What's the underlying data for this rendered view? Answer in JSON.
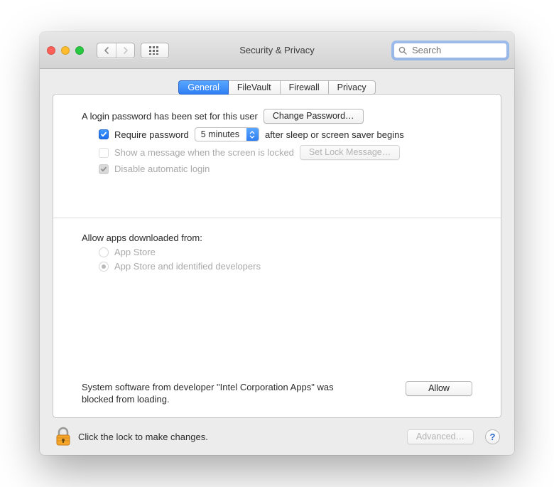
{
  "window": {
    "title": "Security & Privacy"
  },
  "toolbar": {
    "search_placeholder": "Search"
  },
  "tabs": [
    "General",
    "FileVault",
    "Firewall",
    "Privacy"
  ],
  "active_tab": 0,
  "general": {
    "password_set_text": "A login password has been set for this user",
    "change_password_btn": "Change Password…",
    "require_password_label": "Require password",
    "delay_value": "5 minutes",
    "after_sleep_text": "after sleep or screen saver begins",
    "show_message_label": "Show a message when the screen is locked",
    "set_lock_message_btn": "Set Lock Message…",
    "disable_auto_login_label": "Disable automatic login",
    "allow_apps_heading": "Allow apps downloaded from:",
    "radio_app_store": "App Store",
    "radio_identified": "App Store and identified developers",
    "blocked_text": "System software from developer \"Intel Corporation Apps\" was blocked from loading.",
    "allow_btn": "Allow"
  },
  "footer": {
    "lock_text": "Click the lock to make changes.",
    "advanced_btn": "Advanced…"
  }
}
